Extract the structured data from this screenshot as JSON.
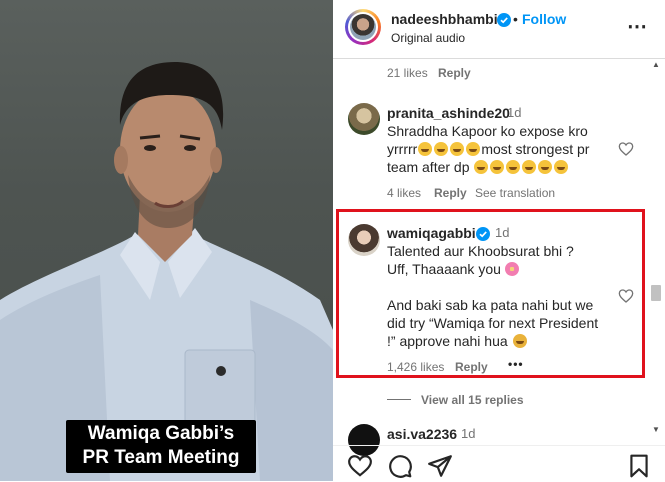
{
  "video": {
    "caption_line1": "Wamiqa Gabbi’s",
    "caption_line2": "PR Team Meeting"
  },
  "header": {
    "username": "nadeeshbhambi",
    "follow_label": "Follow",
    "separator": "•",
    "subtitle": "Original audio",
    "more_icon": "⋯"
  },
  "comments": {
    "prev_meta": {
      "likes": "21 likes",
      "reply": "Reply"
    },
    "c1": {
      "username": "pranita_ashinde20",
      "time": "1d",
      "line1": "Shraddha Kapoor ko expose kro",
      "line2": "yrrrrr",
      "line2_tail": "most strongest pr",
      "line3": "team after dp",
      "likes": "4 likes",
      "reply": "Reply",
      "translate": "See translation"
    },
    "c2": {
      "username": "wamiqagabbi",
      "time": "1d",
      "line1": "Talented aur Khoobsurat bhi ?",
      "line2": "Uff, Thaaaank you",
      "line3": "And baki sab ka pata nahi but we",
      "line4": "did try “Wamiqa for next President",
      "line5": "!” approve nahi hua",
      "likes": "1,426 likes",
      "reply": "Reply",
      "more": "•••"
    },
    "view_replies": "View all 15 replies",
    "c3": {
      "username": "asi.va2236",
      "time": "1d"
    }
  },
  "colors": {
    "accent": "#0095f6",
    "highlight": "#e0121c"
  },
  "icons": [
    "verified-badge-icon",
    "heart-icon",
    "comment-icon",
    "share-icon",
    "bookmark-icon"
  ]
}
